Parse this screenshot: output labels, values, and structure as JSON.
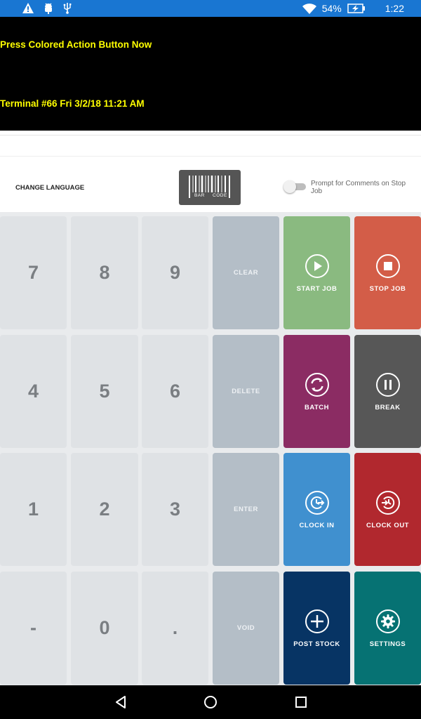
{
  "status": {
    "battery": "54%",
    "time": "1:22",
    "icons": [
      "warning-icon",
      "android-debug-icon",
      "usb-icon",
      "wifi-icon",
      "battery-charging-icon"
    ]
  },
  "header": {
    "prompt": "Press Colored Action Button Now",
    "terminal": "Terminal #66 Fri 3/2/18 11:21 AM",
    "text_color": "#ffff00",
    "background": "#000000"
  },
  "options": {
    "change_language": "CHANGE LANGUAGE",
    "barcode_top": "",
    "barcode_left": "BAR",
    "barcode_right": "CODE",
    "toggle_label": "Prompt for Comments on Stop Job",
    "toggle_on": false
  },
  "keypad": {
    "numbers": [
      "7",
      "8",
      "9",
      "4",
      "5",
      "6",
      "1",
      "2",
      "3",
      "-",
      "0",
      "."
    ],
    "functions": [
      "CLEAR",
      "DELETE",
      "ENTER",
      "VOID"
    ]
  },
  "actions": {
    "start_job": {
      "label": "START JOB",
      "color": "#8aba80",
      "icon": "play-icon"
    },
    "stop_job": {
      "label": "STOP JOB",
      "color": "#d35d48",
      "icon": "stop-icon"
    },
    "batch": {
      "label": "BATCH",
      "color": "#8b2c63",
      "icon": "refresh-icon"
    },
    "break": {
      "label": "BREAK",
      "color": "#575757",
      "icon": "pause-icon"
    },
    "clock_in": {
      "label": "CLOCK IN",
      "color": "#4090cf",
      "icon": "clock-in-icon"
    },
    "clock_out": {
      "label": "CLOCK OUT",
      "color": "#b1282e",
      "icon": "clock-out-icon"
    },
    "post_stock": {
      "label": "POST STOCK",
      "color": "#073464",
      "icon": "plus-circle-icon"
    },
    "settings": {
      "label": "SETTINGS",
      "color": "#067273",
      "icon": "gear-icon"
    }
  },
  "nav": {
    "icons": [
      "back-icon",
      "home-icon",
      "recents-icon"
    ]
  }
}
